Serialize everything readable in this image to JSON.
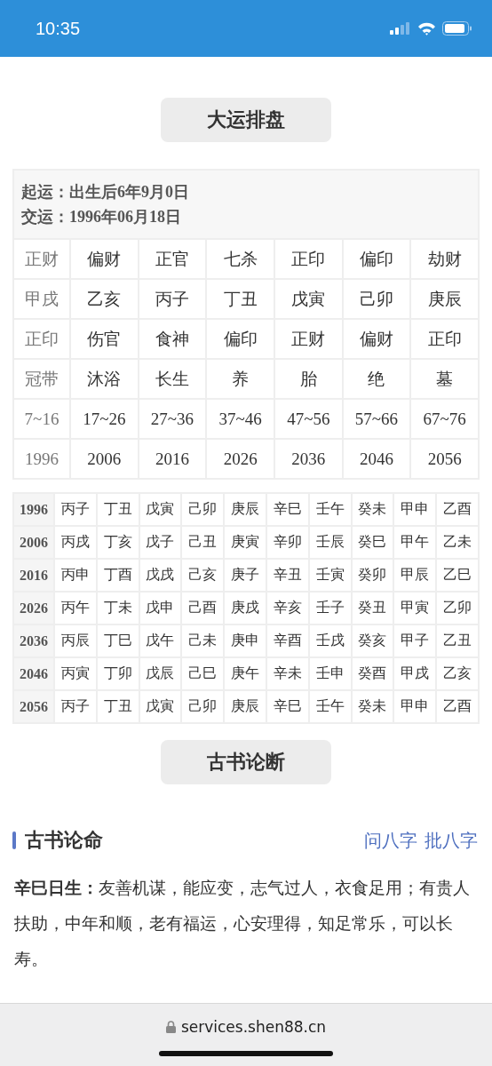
{
  "status_bar": {
    "time": "10:35"
  },
  "dayun_button": "大运排盘",
  "dayun_table": {
    "info_lines": [
      "起运：出生后6年9月0日",
      "交运：1996年06月18日"
    ],
    "rows": [
      [
        "正财",
        "偏财",
        "正官",
        "七杀",
        "正印",
        "偏印",
        "劫财"
      ],
      [
        "甲戌",
        "乙亥",
        "丙子",
        "丁丑",
        "戊寅",
        "己卯",
        "庚辰"
      ],
      [
        "正印",
        "伤官",
        "食神",
        "偏印",
        "正财",
        "偏财",
        "正印"
      ],
      [
        "冠带",
        "沐浴",
        "长生",
        "养",
        "胎",
        "绝",
        "墓"
      ],
      [
        "7~16",
        "17~26",
        "27~36",
        "37~46",
        "47~56",
        "57~66",
        "67~76"
      ],
      [
        "1996",
        "2006",
        "2016",
        "2026",
        "2036",
        "2046",
        "2056"
      ]
    ]
  },
  "liunian_table": {
    "rows": [
      {
        "year": "1996",
        "cells": [
          "丙子",
          "丁丑",
          "戊寅",
          "己卯",
          "庚辰",
          "辛巳",
          "壬午",
          "癸未",
          "甲申",
          "乙酉"
        ]
      },
      {
        "year": "2006",
        "cells": [
          "丙戌",
          "丁亥",
          "戊子",
          "己丑",
          "庚寅",
          "辛卯",
          "壬辰",
          "癸巳",
          "甲午",
          "乙未"
        ]
      },
      {
        "year": "2016",
        "cells": [
          "丙申",
          "丁酉",
          "戊戌",
          "己亥",
          "庚子",
          "辛丑",
          "壬寅",
          "癸卯",
          "甲辰",
          "乙巳"
        ]
      },
      {
        "year": "2026",
        "cells": [
          "丙午",
          "丁未",
          "戊申",
          "己酉",
          "庚戌",
          "辛亥",
          "壬子",
          "癸丑",
          "甲寅",
          "乙卯"
        ]
      },
      {
        "year": "2036",
        "cells": [
          "丙辰",
          "丁巳",
          "戊午",
          "己未",
          "庚申",
          "辛酉",
          "壬戌",
          "癸亥",
          "甲子",
          "乙丑"
        ]
      },
      {
        "year": "2046",
        "cells": [
          "丙寅",
          "丁卯",
          "戊辰",
          "己巳",
          "庚午",
          "辛未",
          "壬申",
          "癸酉",
          "甲戌",
          "乙亥"
        ]
      },
      {
        "year": "2056",
        "cells": [
          "丙子",
          "丁丑",
          "戊寅",
          "己卯",
          "庚辰",
          "辛巳",
          "壬午",
          "癸未",
          "甲申",
          "乙酉"
        ]
      }
    ]
  },
  "gushu_button": "古书论断",
  "section": {
    "title": "古书论命",
    "links": [
      "问八字",
      "批八字"
    ]
  },
  "paragraph": "**辛巳日生：**友善机谋，能应变，志气过人，衣食足用；有贵人扶助，中年和顺，老有福运，心安理得，知足常乐，可以长寿。",
  "address_bar": {
    "url": "services.shen88.cn"
  }
}
